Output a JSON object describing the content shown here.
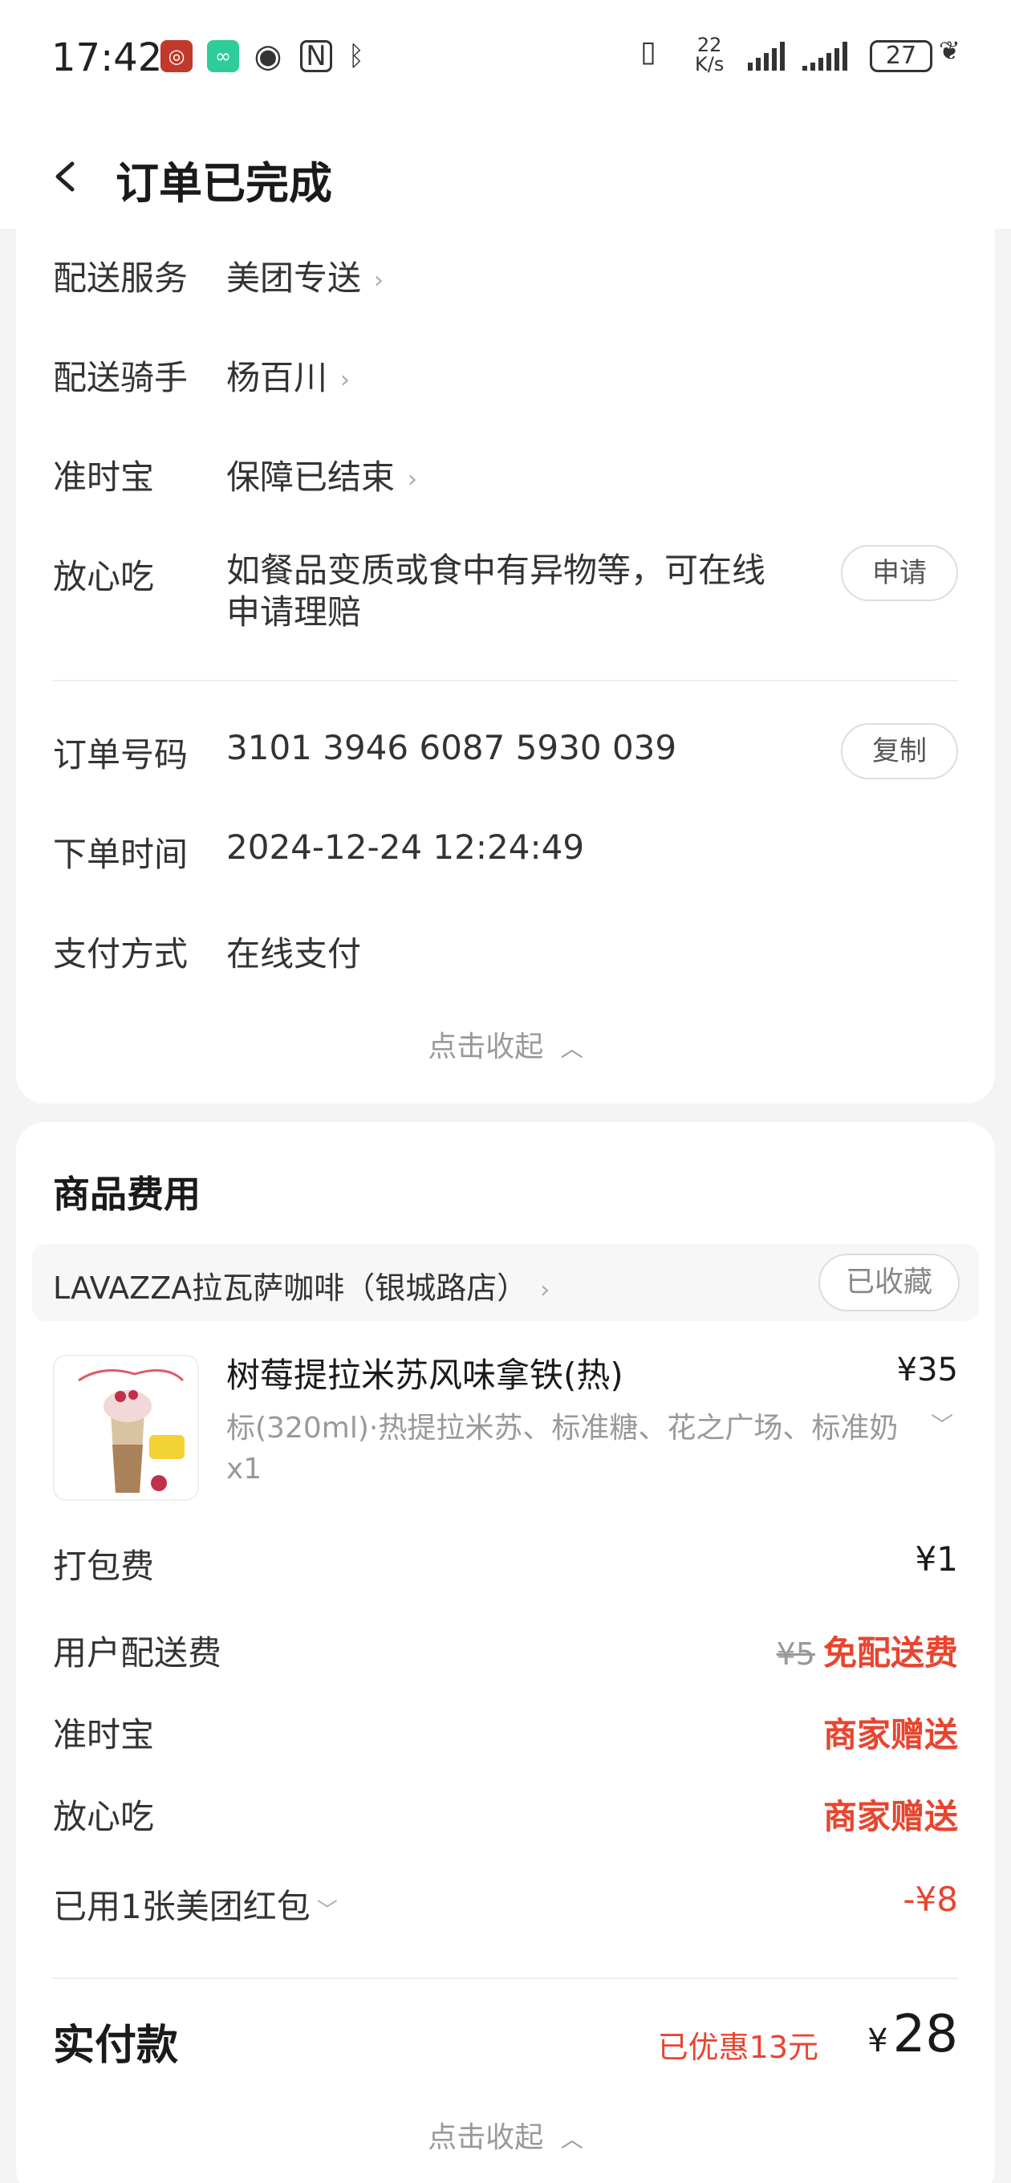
{
  "status_bar": {
    "time": "17:42",
    "net_speed_value": "22",
    "net_speed_unit": "K/s",
    "battery": "27",
    "icons": [
      "app-red-icon",
      "tripadvisor-icon",
      "eye-icon",
      "nfc-icon",
      "bluetooth-icon",
      "vibrate-icon",
      "signal-icon",
      "signal-icon",
      "leaf-icon"
    ]
  },
  "header": {
    "back_icon": "chevron-left-icon",
    "title": "订单已完成"
  },
  "delivery": {
    "service_label": "配送服务",
    "service_value": "美团专送",
    "rider_label": "配送骑手",
    "rider_value": "杨百川",
    "ontime_label": "准时宝",
    "ontime_value": "保障已结束",
    "safe_label": "放心吃",
    "safe_value_line1": "如餐品变质或食中有异物等，可在线",
    "safe_value_line2": "申请理赔",
    "apply_button": "申请"
  },
  "order": {
    "number_label": "订单号码",
    "number_value": "3101 3946 6087 5930 039",
    "copy_button": "复制",
    "time_label": "下单时间",
    "time_value": "2024-12-24 12:24:49",
    "pay_label": "支付方式",
    "pay_value": "在线支付",
    "collapse_label": "点击收起"
  },
  "fees": {
    "section_title": "商品费用",
    "store_name": "LAVAZZA拉瓦萨咖啡（银城路店）",
    "favorite_button": "已收藏",
    "product": {
      "name": "树莓提拉米苏风味拿铁(热)",
      "price": "¥35",
      "spec": "标(320ml)·热提拉米苏、标准糖、花之广场、标准奶",
      "qty": "x1"
    },
    "packing_label": "打包费",
    "packing_value": "¥1",
    "delivery_label": "用户配送费",
    "delivery_original": "¥5",
    "delivery_value": "免配送费",
    "ontime_label": "准时宝",
    "ontime_value": "商家赠送",
    "safe_label": "放心吃",
    "safe_value": "商家赠送",
    "coupon_label": "已用1张美团红包",
    "coupon_value": "-¥8",
    "total_label": "实付款",
    "discount_note": "已优惠13元",
    "total_currency": "¥",
    "total_value": "28",
    "collapse_label": "点击收起"
  },
  "colors": {
    "accent_red": "#e8452f",
    "background": "#f4f4f4"
  }
}
